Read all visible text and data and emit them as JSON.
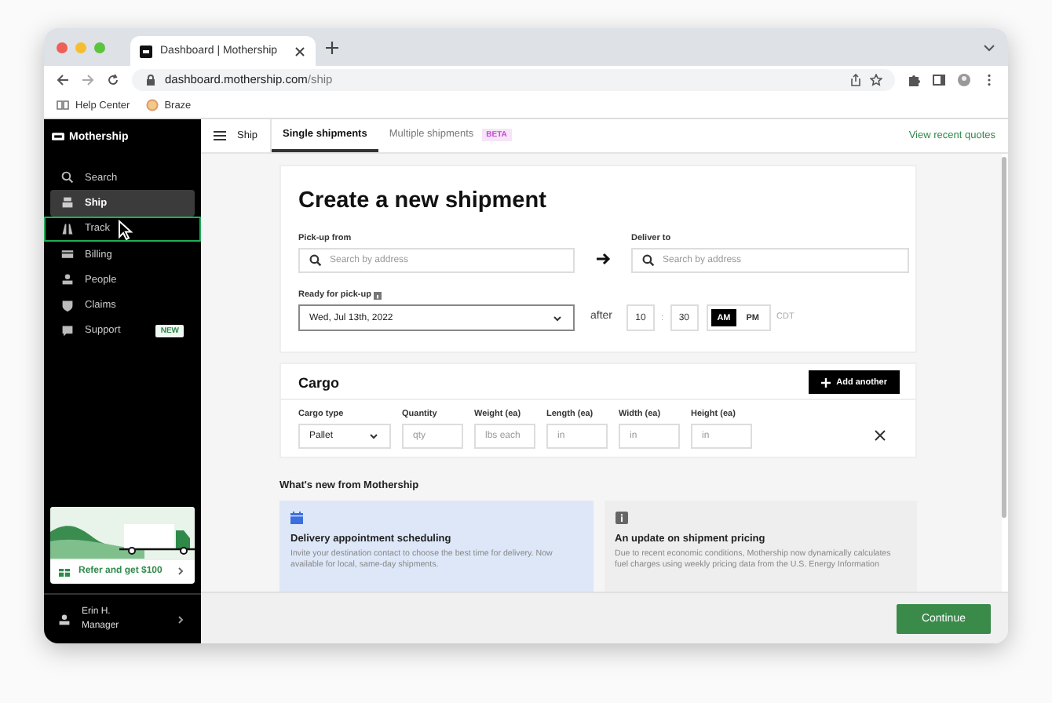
{
  "browser": {
    "tab_title": "Dashboard | Mothership",
    "url_host": "dashboard.mothership.com",
    "url_path": "/ship",
    "bookmarks": [
      {
        "label": "Help Center",
        "kind": "book"
      },
      {
        "label": "Braze",
        "kind": "globe"
      }
    ]
  },
  "sidebar": {
    "logo": "Mothership",
    "items": [
      {
        "label": "Search",
        "kind": "search",
        "selected": false,
        "outlined": false
      },
      {
        "label": "Ship",
        "kind": "ship",
        "selected": true,
        "outlined": false
      },
      {
        "label": "Track",
        "kind": "track",
        "selected": false,
        "outlined": true
      },
      {
        "label": "Billing",
        "kind": "billing",
        "selected": false,
        "outlined": false
      },
      {
        "label": "People",
        "kind": "people",
        "selected": false,
        "outlined": false
      },
      {
        "label": "Claims",
        "kind": "claims",
        "selected": false,
        "outlined": false
      },
      {
        "label": "Support",
        "kind": "support",
        "selected": false,
        "outlined": false,
        "badge": "NEW"
      }
    ],
    "promo": {
      "label": "Refer and get $100"
    },
    "user": {
      "name": "Erin H.",
      "role": "Manager"
    }
  },
  "topbar": {
    "section": "Ship",
    "tabs": [
      {
        "label": "Single shipments",
        "selected": true
      },
      {
        "label": "Multiple shipments",
        "selected": false,
        "badge": "BETA"
      }
    ],
    "link": "View recent quotes"
  },
  "form": {
    "title": "Create a new shipment",
    "pickup": {
      "label": "Pick-up from",
      "placeholder": "Search by address"
    },
    "deliver": {
      "label": "Deliver to",
      "placeholder": "Search by address"
    },
    "ready": {
      "label": "Ready for pick-up",
      "value": "Wed, Jul 13th, 2022"
    },
    "after": "after",
    "hour": "10",
    "separator": ":",
    "minute": "30",
    "meridiem": [
      {
        "label": "AM",
        "selected": true
      },
      {
        "label": "PM",
        "selected": false
      }
    ],
    "timezone": "CDT"
  },
  "cargo": {
    "title": "Cargo",
    "add_button": "Add another",
    "fields": [
      {
        "label": "Cargo type",
        "kind": "select",
        "value": "Pallet"
      },
      {
        "label": "Quantity",
        "kind": "input",
        "placeholder": "qty"
      },
      {
        "label": "Weight (ea)",
        "kind": "input",
        "placeholder": "lbs each"
      },
      {
        "label": "Length (ea)",
        "kind": "input",
        "placeholder": "in"
      },
      {
        "label": "Width (ea)",
        "kind": "input",
        "placeholder": "in"
      },
      {
        "label": "Height (ea)",
        "kind": "input",
        "placeholder": "in"
      }
    ]
  },
  "whats_new": {
    "title": "What's new from Mothership",
    "cards": [
      {
        "kind": "calendar",
        "title": "Delivery appointment scheduling",
        "body": "Invite your destination contact to choose the best time for delivery. Now available for local, same-day shipments."
      },
      {
        "kind": "info",
        "title": "An update on shipment pricing",
        "body": "Due to recent economic conditions, Mothership now dynamically calculates fuel charges using weekly pricing data from the U.S. Energy Information"
      }
    ]
  },
  "footer": {
    "continue_button": "Continue"
  }
}
